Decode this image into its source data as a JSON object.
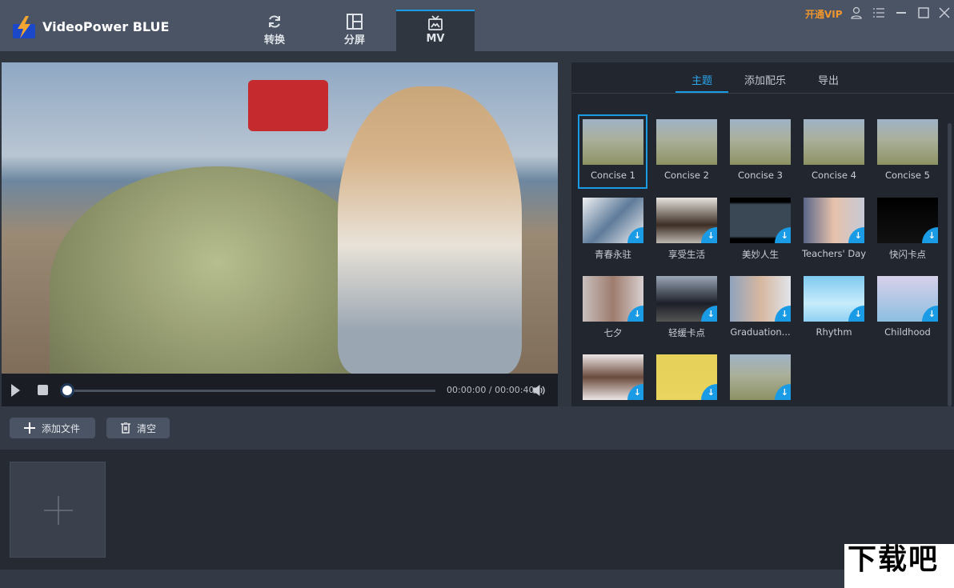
{
  "app": {
    "title": "VideoPower BLUE",
    "vip_label": "开通VIP"
  },
  "nav_tabs": [
    {
      "label": "转换",
      "icon": "refresh-icon"
    },
    {
      "label": "分屏",
      "icon": "split-screen-icon"
    },
    {
      "label": "MV",
      "icon": "tv-icon",
      "active": true
    }
  ],
  "player": {
    "current_time": "00:00:00",
    "total_time": "00:00:40",
    "time_display": "00:00:00 / 00:00:40",
    "progress": 0
  },
  "right_tabs": [
    {
      "label": "主题",
      "active": true
    },
    {
      "label": "添加配乐"
    },
    {
      "label": "导出"
    }
  ],
  "themes": [
    {
      "label": "Concise 1",
      "selected": true,
      "download": false
    },
    {
      "label": "Concise 2",
      "download": false
    },
    {
      "label": "Concise 3",
      "download": false
    },
    {
      "label": "Concise 4",
      "download": false
    },
    {
      "label": "Concise 5",
      "download": false
    },
    {
      "label": "青春永驻",
      "download": true
    },
    {
      "label": "享受生活",
      "download": true
    },
    {
      "label": "美妙人生",
      "download": true
    },
    {
      "label": "Teachers' Day",
      "download": true
    },
    {
      "label": "快闪卡点",
      "download": true
    },
    {
      "label": "七夕",
      "download": true
    },
    {
      "label": "轻缓卡点",
      "download": true
    },
    {
      "label": "Graduation...",
      "download": true
    },
    {
      "label": "Rhythm",
      "download": true
    },
    {
      "label": "Childhood",
      "download": true
    },
    {
      "label": "",
      "download": true
    },
    {
      "label": "",
      "download": true
    },
    {
      "label": "",
      "download": true
    }
  ],
  "toolbar": {
    "add_file": "添加文件",
    "clear": "清空"
  },
  "watermark": {
    "text": "下载吧",
    "url": "www.xiazaiba.com"
  },
  "colors": {
    "accent": "#1a9be6",
    "vip": "#f0962e"
  }
}
